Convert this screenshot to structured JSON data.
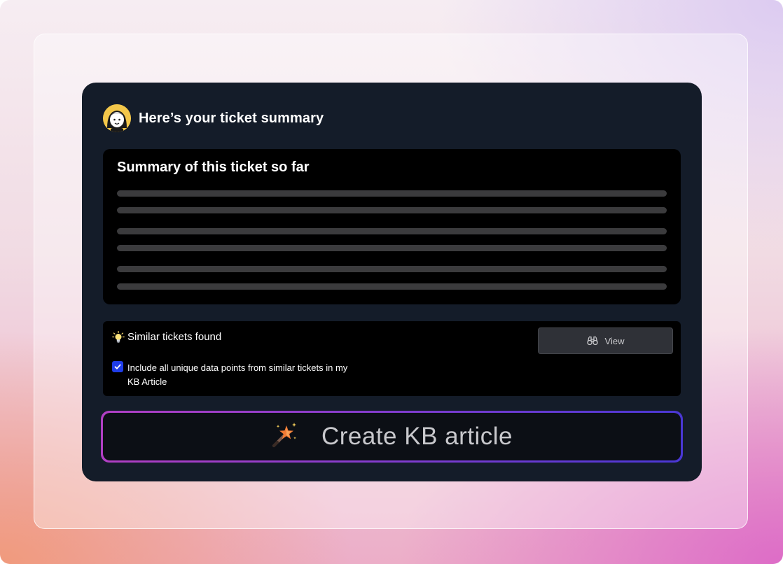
{
  "header": {
    "title": "Here’s your ticket summary",
    "avatar_icon": "assistant-avatar-icon"
  },
  "summary": {
    "title": "Summary of this ticket so far",
    "placeholder_lines": 6
  },
  "similar": {
    "title": "Similar tickets found",
    "icon": "lightbulb-icon",
    "checkbox_checked": true,
    "checkbox_label": "Include all unique data points from similar tickets in my KB Article",
    "view_label": "View",
    "view_icon": "binoculars-icon"
  },
  "create": {
    "label": "Create KB article",
    "icon": "magic-wand-icon"
  },
  "colors": {
    "card": "#141c29",
    "panel": "#000000",
    "checkbox": "#1f3de8",
    "button_gradient_start": "#b13fc3",
    "button_gradient_end": "#4a37d4"
  }
}
